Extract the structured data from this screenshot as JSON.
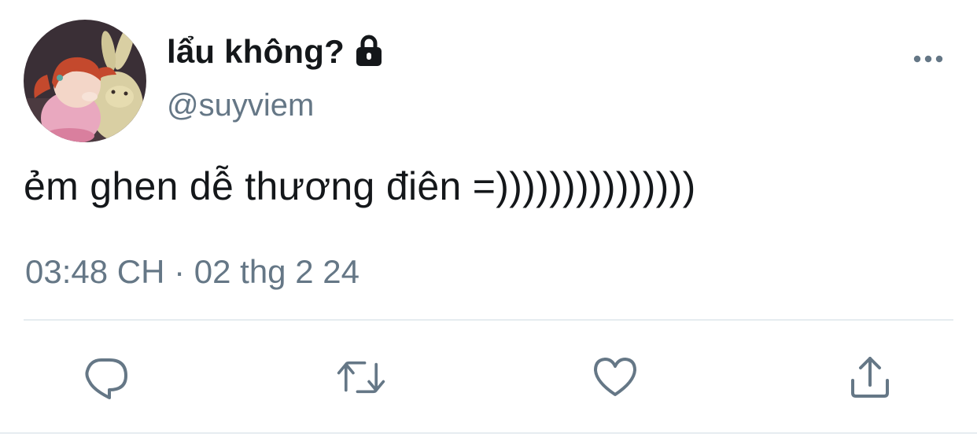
{
  "user": {
    "display_name": "lẩu không?",
    "handle": "@suyviem",
    "protected_icon": "lock-icon",
    "avatar": "avatar"
  },
  "tweet": {
    "text": "ẻm ghen dễ thương điên =)))))))))))))))",
    "timestamp": "03:48 CH · 02 thg 2 24"
  },
  "actions": {
    "reply_icon": "reply-icon",
    "retweet_icon": "retweet-icon",
    "like_icon": "heart-icon",
    "share_icon": "share-icon",
    "more_icon": "more-icon"
  },
  "colors": {
    "text_primary": "#14171a",
    "text_secondary": "#657786",
    "icon_gray": "#657786",
    "divider": "#e6ecf0"
  }
}
